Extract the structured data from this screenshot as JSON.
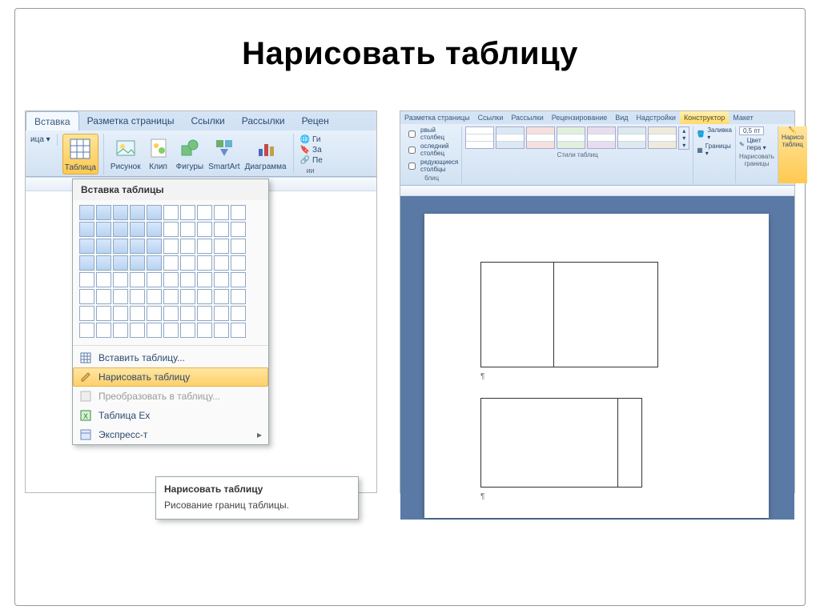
{
  "slide": {
    "title": "Нарисовать таблицу"
  },
  "left": {
    "tabs": [
      "Вставка",
      "Разметка страницы",
      "Ссылки",
      "Рассылки",
      "Рецен"
    ],
    "active_tab": 0,
    "truncated_group": "ица ▾",
    "buttons": {
      "table": "Таблица",
      "picture": "Рисунок",
      "clip": "Клип",
      "shapes": "Фигуры",
      "smartart": "SmartArt",
      "chart": "Диаграмма"
    },
    "side_items": {
      "hyperlink": "Ги",
      "bookmark": "За",
      "crossref": "Пе",
      "caption": "ии"
    },
    "dropdown": {
      "title": "Вставка таблицы",
      "grid_rows": 8,
      "grid_cols": 10,
      "sel_rows": 4,
      "sel_cols": 5,
      "items": {
        "insert": "Вставить таблицу...",
        "draw": "Нарисовать таблицу",
        "convert": "Преобразовать в таблицу...",
        "excel": "Таблица Ex",
        "quick": "Экспресс-т"
      }
    },
    "tooltip": {
      "title": "Нарисовать таблицу",
      "body": "Рисование границ таблицы."
    }
  },
  "right": {
    "tabs": [
      "Разметка страницы",
      "Ссылки",
      "Рассылки",
      "Рецензирование",
      "Вид",
      "Надстройки",
      "Конструктор",
      "Макет"
    ],
    "ctx_tab_index": 6,
    "options": {
      "header": "рвый столбец",
      "last": "оследний столбец",
      "banded": "редующиеся столбцы"
    },
    "groups": {
      "options_label": "блиц",
      "styles_label": "Стили таблиц"
    },
    "tools": {
      "shading": "Заливка ▾",
      "borders": "Границы ▾",
      "pen": "Цвет пера ▾",
      "weight": "0,5 пт",
      "draw": "Нарисо таблиц",
      "draw_group": "Нарисовать границы"
    }
  }
}
